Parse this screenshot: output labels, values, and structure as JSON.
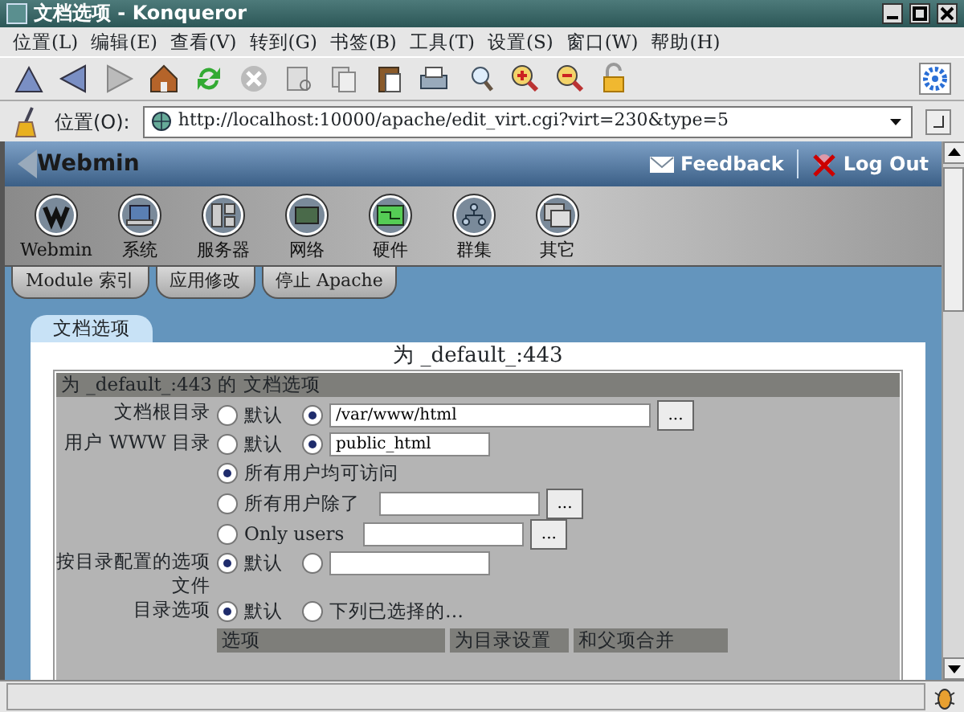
{
  "window": {
    "title": "文档选项 - Konqueror"
  },
  "menu": [
    "位置(L)",
    "编辑(E)",
    "查看(V)",
    "转到(G)",
    "书签(B)",
    "工具(T)",
    "设置(S)",
    "窗口(W)",
    "帮助(H)"
  ],
  "location": {
    "label": "位置(O):",
    "url": "http://localhost:10000/apache/edit_virt.cgi?virt=230&type=5"
  },
  "webmin": {
    "logo": "Webmin",
    "links": [
      "Feedback",
      "Log Out"
    ],
    "categories": [
      {
        "label": "Webmin"
      },
      {
        "label": "系统"
      },
      {
        "label": "服务器"
      },
      {
        "label": "网络"
      },
      {
        "label": "硬件"
      },
      {
        "label": "群集"
      },
      {
        "label": "其它"
      }
    ],
    "module_tabs": [
      "Module 索引",
      "应用修改",
      "停止 Apache"
    ]
  },
  "form_tab": "文档选项",
  "heading": "为 _default_:443",
  "section_title": "为 _default_:443 的 文档选项",
  "form_rows": [
    {
      "label": "文档根目录",
      "lines": [
        [
          {
            "kind": "radio",
            "selected": false,
            "text": "默认"
          },
          {
            "kind": "radio",
            "selected": true
          },
          {
            "kind": "input",
            "value": "/var/www/html"
          },
          {
            "kind": "button",
            "text": "..."
          }
        ]
      ]
    },
    {
      "label": "用户 WWW 目录",
      "lines": [
        [
          {
            "kind": "radio",
            "selected": false,
            "text": "默认"
          },
          {
            "kind": "radio",
            "selected": true
          },
          {
            "kind": "input",
            "value": "public_html"
          }
        ],
        [
          {
            "kind": "radio",
            "selected": true,
            "text": "所有用户均可访问"
          }
        ],
        [
          {
            "kind": "radio",
            "selected": false,
            "text": "所有用户除了"
          },
          {
            "kind": "input"
          },
          {
            "kind": "button",
            "text": "..."
          }
        ],
        [
          {
            "kind": "radio",
            "selected": false,
            "text": "Only users"
          },
          {
            "kind": "input"
          },
          {
            "kind": "button",
            "text": "..."
          }
        ]
      ]
    },
    {
      "label": "按目录配置的选项文件",
      "lines": [
        [
          {
            "kind": "radio",
            "selected": true,
            "text": "默认"
          },
          {
            "kind": "radio",
            "selected": false
          },
          {
            "kind": "input"
          }
        ]
      ]
    },
    {
      "label": "目录选项",
      "lines": [
        [
          {
            "kind": "radio",
            "selected": true,
            "text": "默认"
          },
          {
            "kind": "radio",
            "selected": false,
            "text": "下列已选择的…"
          }
        ]
      ]
    }
  ],
  "options_table": {
    "columns": [
      "选项",
      "为目录设置",
      "和父项合并"
    ]
  }
}
